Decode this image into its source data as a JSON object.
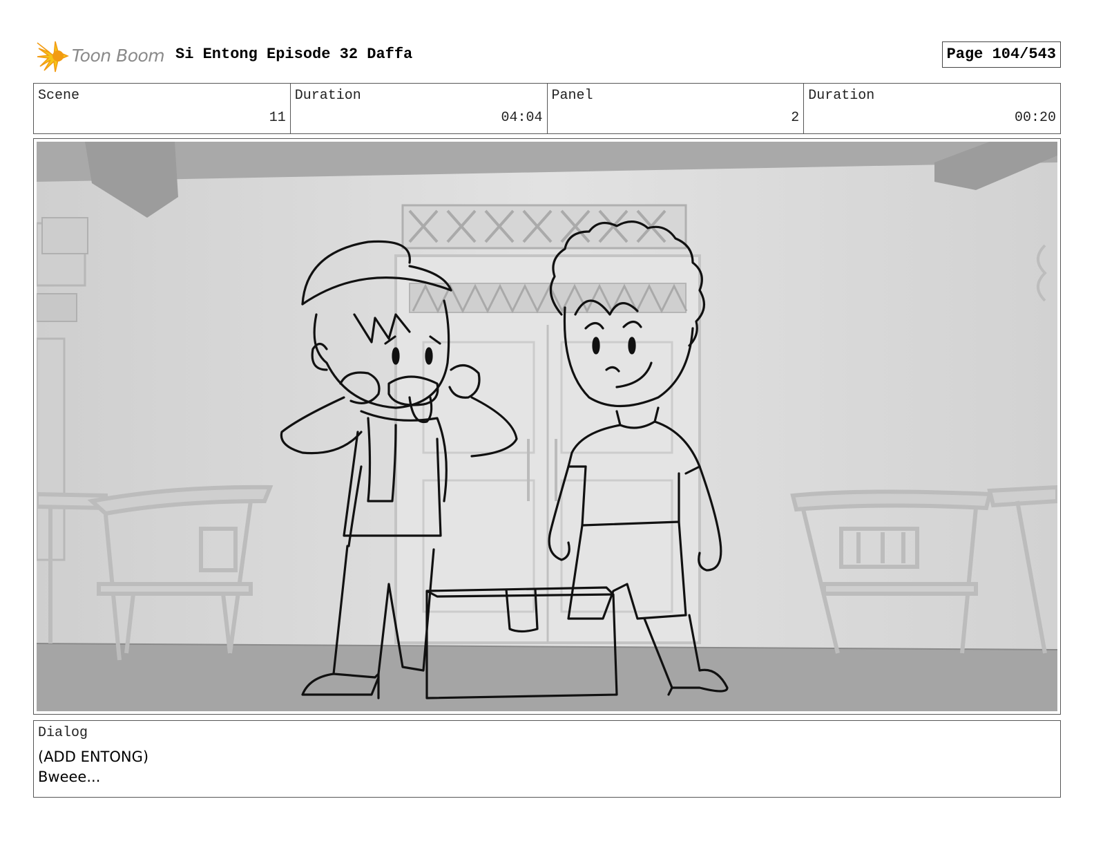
{
  "header": {
    "logo_text": "Toon Boom",
    "project_title": "Si Entong Episode 32 Daffa",
    "page_label": "Page 104/543"
  },
  "info": {
    "scene_label": "Scene",
    "scene_value": "11",
    "scene_duration_label": "Duration",
    "scene_duration_value": "04:04",
    "panel_label": "Panel",
    "panel_value": "2",
    "panel_duration_label": "Duration",
    "panel_duration_value": "00:20"
  },
  "dialog": {
    "label": "Dialog",
    "lines": [
      "(ADD ENTONG)",
      "Bweee..."
    ]
  },
  "colors": {
    "logo_yellow": "#f5c518",
    "logo_orange": "#f29b12",
    "panel_background": "#d9d9d9",
    "sketch_line": "#111111"
  }
}
